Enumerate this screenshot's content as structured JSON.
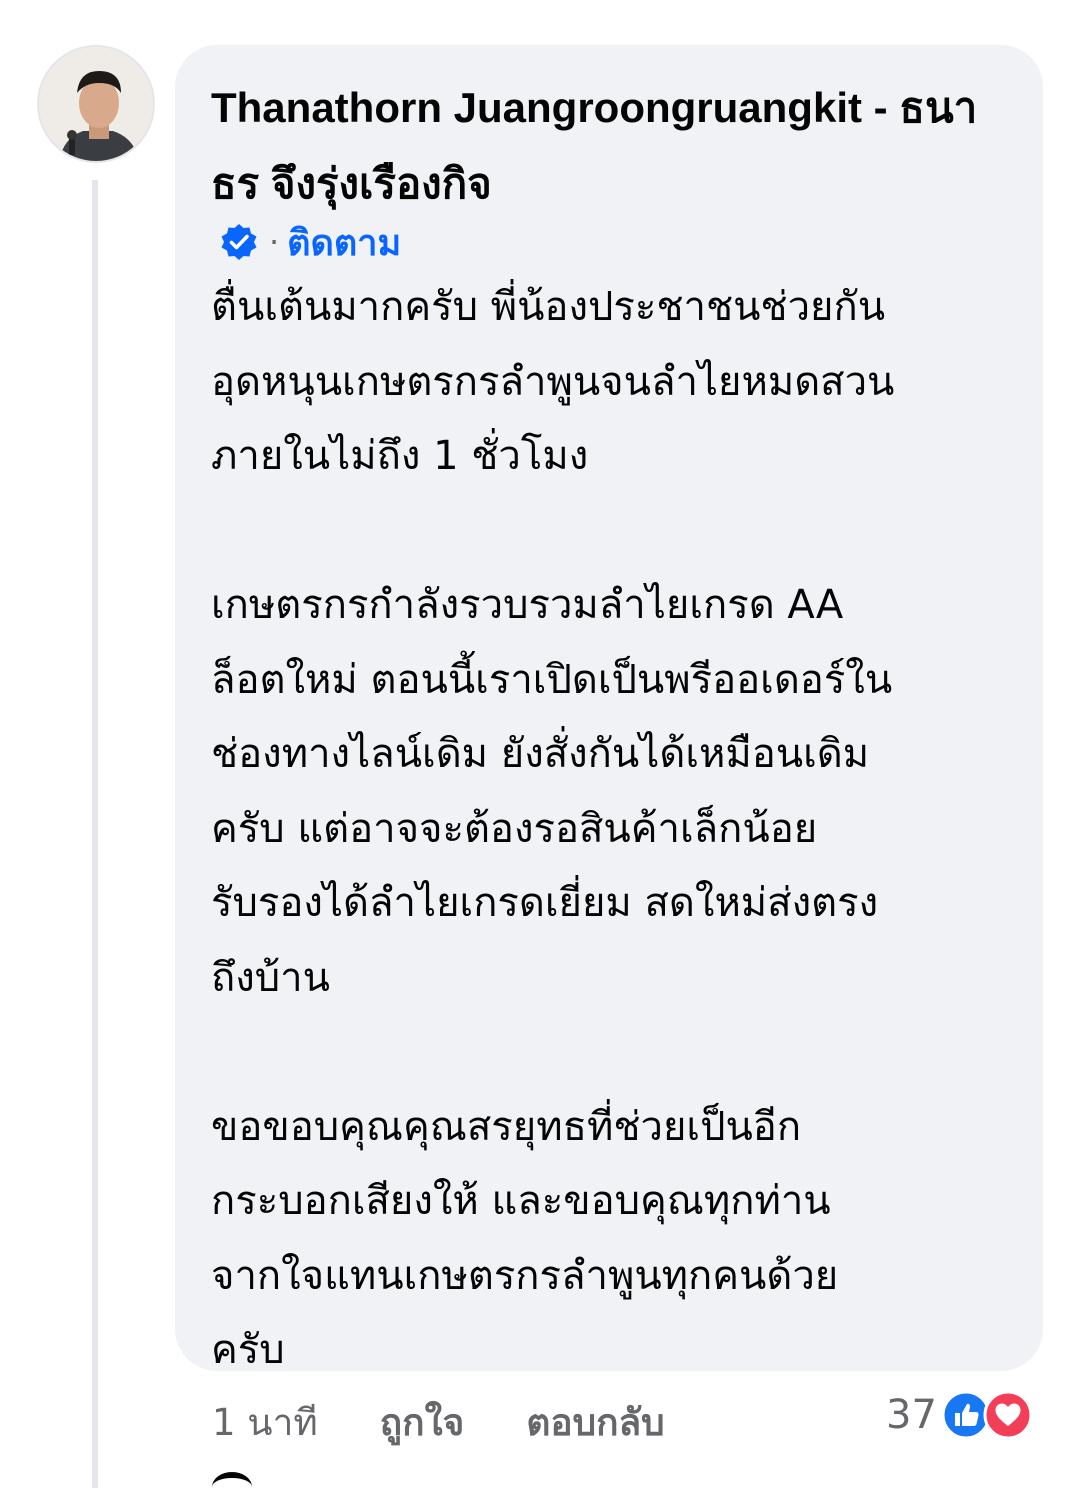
{
  "comment": {
    "author_name": "Thanathorn Juangroongruangkit - ธนา\nธร จึงรุ่งเรืองกิจ",
    "follow_label": "ติดตาม",
    "body": "ตื่นเต้นมากครับ พี่น้องประชาชนช่วยกัน\nอุดหนุนเกษตรกรลำพูนจนลำไยหมดสวน\nภายในไม่ถึง 1 ชั่วโมง\n\nเกษตรกรกำลังรวบรวมลำไยเกรด AA\nล็อตใหม่ ตอนนี้เราเปิดเป็นพรีออเดอร์ใน\nช่องทางไลน์เดิม ยังสั่งกันได้เหมือนเดิม\nครับ แต่อาจจะต้องรอสินค้าเล็กน้อย\nรับรองได้ลำไยเกรดเยี่ยม สดใหม่ส่งตรง\nถึงบ้าน\n\nขอขอบคุณคุณสรยุทธที่ช่วยเป็นอีก\nกระบอกเสียงให้ และขอบคุณทุกท่าน\nจากใจแทนเกษตรกรลำพูนทุกคนด้วย\nครับ",
    "timestamp": "1 นาที",
    "like_label": "ถูกใจ",
    "reply_label": "ตอบกลับ",
    "reaction_count": "37",
    "reaction_icons": [
      "like-icon",
      "love-icon"
    ],
    "verified_icon": "verified-badge-icon"
  },
  "colors": {
    "bubble": "#f0f2f5",
    "link_blue": "#0866ff",
    "secondary_text": "#65676b",
    "like_blue": "#1877f2",
    "love_red": "#f33e58"
  }
}
